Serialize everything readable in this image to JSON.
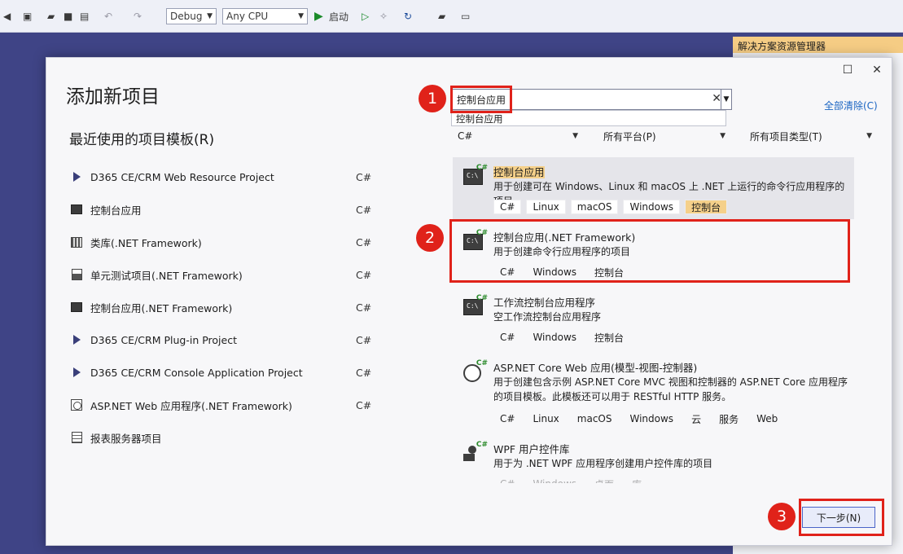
{
  "toolbar": {
    "config": "Debug",
    "platform": "Any CPU",
    "start_label": "启动"
  },
  "solution_explorer": {
    "title": "解决方案资源管理器"
  },
  "dialog": {
    "title": "添加新项目",
    "recent_title": "最近使用的项目模板(R)",
    "search_value": "控制台应用",
    "search_suggestion": "控制台应用",
    "clear_all": "全部清除(C)",
    "filters": {
      "language": "C#",
      "platform": "所有平台(P)",
      "project_type": "所有项目类型(T)"
    },
    "next_button": "下一步(N)"
  },
  "recent": [
    {
      "name": "D365 CE/CRM Web Resource Project",
      "lang": "C#",
      "icon": "d365-icon"
    },
    {
      "name": "控制台应用",
      "lang": "C#",
      "icon": "console-icon"
    },
    {
      "name": "类库(.NET Framework)",
      "lang": "C#",
      "icon": "library-icon"
    },
    {
      "name": "单元测试项目(.NET Framework)",
      "lang": "C#",
      "icon": "test-icon"
    },
    {
      "name": "控制台应用(.NET Framework)",
      "lang": "C#",
      "icon": "console-icon"
    },
    {
      "name": "D365 CE/CRM Plug-in Project",
      "lang": "C#",
      "icon": "d365-icon"
    },
    {
      "name": "D365 CE/CRM Console Application Project",
      "lang": "C#",
      "icon": "d365-icon"
    },
    {
      "name": "ASP.NET Web 应用程序(.NET Framework)",
      "lang": "C#",
      "icon": "web-icon"
    },
    {
      "name": "报表服务器项目",
      "lang": "",
      "icon": "report-icon"
    }
  ],
  "templates": [
    {
      "name": "控制台应用",
      "desc": "用于创建可在 Windows、Linux 和 macOS 上 .NET 上运行的命令行应用程序的项目",
      "tags": [
        "C#",
        "Linux",
        "macOS",
        "Windows",
        "控制台"
      ]
    },
    {
      "name": "控制台应用(.NET Framework)",
      "desc": "用于创建命令行应用程序的项目",
      "tags": [
        "C#",
        "Windows",
        "控制台"
      ]
    },
    {
      "name": "工作流控制台应用程序",
      "desc": "空工作流控制台应用程序",
      "tags": [
        "C#",
        "Windows",
        "控制台"
      ]
    },
    {
      "name": "ASP.NET Core Web 应用(模型-视图-控制器)",
      "desc": "用于创建包含示例 ASP.NET Core MVC 视图和控制器的 ASP.NET Core 应用程序的项目模板。此模板还可以用于 RESTful HTTP 服务。",
      "tags": [
        "C#",
        "Linux",
        "macOS",
        "Windows",
        "云",
        "服务",
        "Web"
      ]
    },
    {
      "name": "WPF 用户控件库",
      "desc": "用于为 .NET WPF 应用程序创建用户控件库的项目",
      "tags": [
        "C#",
        "Windows",
        "桌面",
        "库"
      ]
    }
  ],
  "annotations": [
    "1",
    "2",
    "3"
  ],
  "colors": {
    "highlight": "#f5d08a",
    "annotation_red": "#e0221a",
    "link": "#1a64c2"
  }
}
